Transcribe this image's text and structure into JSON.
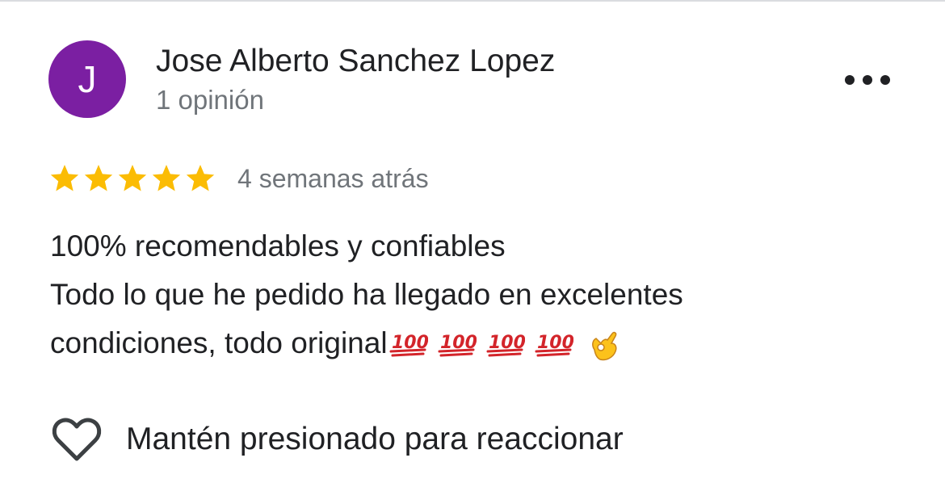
{
  "review": {
    "author": {
      "initial": "J",
      "name": "Jose Alberto Sanchez Lopez",
      "review_count": "1 opinión",
      "avatar_color": "#7b1fa2"
    },
    "menu_icon": "more-horizontal-icon",
    "rating": {
      "stars": 5,
      "max": 5,
      "star_color": "#fbbc04"
    },
    "time_ago": "4 semanas atrás",
    "text_lines": [
      "100% recomendables y confiables",
      "Todo lo que he pedido ha llegado en excelentes",
      "condiciones, todo original"
    ],
    "emojis": [
      "💯",
      "💯",
      "💯",
      "💯",
      "👌"
    ],
    "reaction": {
      "icon": "heart-outline-icon",
      "label": "Mantén presionado para reaccionar"
    }
  }
}
